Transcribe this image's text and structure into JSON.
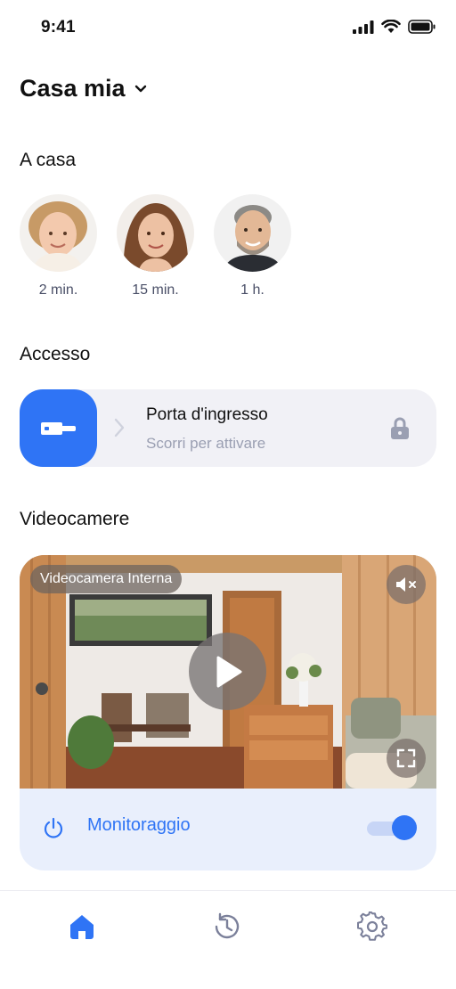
{
  "status_bar": {
    "time": "9:41"
  },
  "header": {
    "home_name": "Casa mia"
  },
  "people_section": {
    "title": "A casa",
    "people": [
      {
        "time": "2 min."
      },
      {
        "time": "15 min."
      },
      {
        "time": "1 h."
      }
    ]
  },
  "access_section": {
    "title": "Accesso",
    "door_name": "Porta d'ingresso",
    "hint": "Scorri per attivare"
  },
  "cameras_section": {
    "title": "Videocamere",
    "camera_name": "Videocamera Interna",
    "monitoring_label": "Monitoraggio",
    "monitoring_on": true,
    "muted": true
  },
  "tab_bar": {
    "tabs": [
      {
        "icon": "home-icon",
        "active": true
      },
      {
        "icon": "history-icon",
        "active": false
      },
      {
        "icon": "settings-icon",
        "active": false
      }
    ]
  },
  "colors": {
    "accent": "#2f74f5",
    "card_bg": "#f1f1f6",
    "muted_text": "#9a9fb2"
  }
}
